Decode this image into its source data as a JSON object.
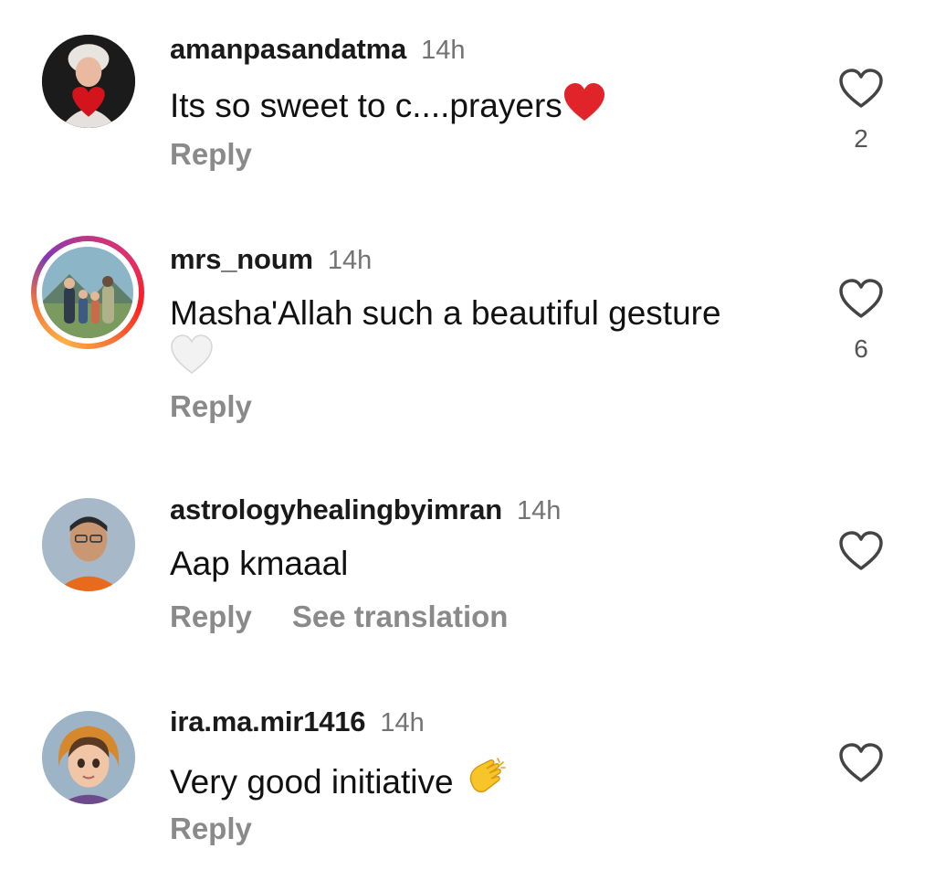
{
  "comments": [
    {
      "username": "amanpasandatma",
      "time": "14h",
      "text": "Its so sweet to c....prayers",
      "emoji": "red-heart",
      "reply_label": "Reply",
      "like_count": "2"
    },
    {
      "username": "mrs_noum",
      "time": "14h",
      "text": "Masha'Allah such a beautiful gesture",
      "emoji": "white-heart",
      "reply_label": "Reply",
      "like_count": "6"
    },
    {
      "username": "astrologyhealingbyimran",
      "time": "14h",
      "text": "Aap kmaaal",
      "reply_label": "Reply",
      "translation_label": "See translation",
      "like_count": ""
    },
    {
      "username": "ira.ma.mir1416",
      "time": "14h",
      "text": "Very good initiative",
      "emoji": "clapping-hands",
      "reply_label": "Reply",
      "like_count": ""
    }
  ]
}
